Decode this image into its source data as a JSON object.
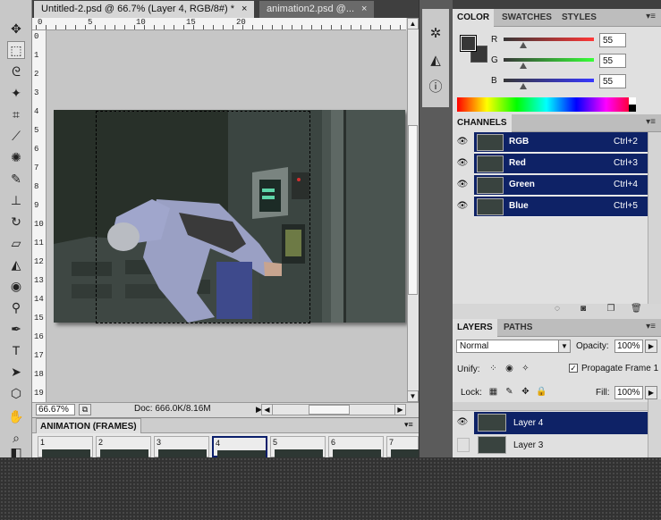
{
  "document": {
    "tabs": [
      {
        "label": "Untitled-2.psd @ 66.7% (Layer 4, RGB/8#) *",
        "active": true
      },
      {
        "label": "animation2.psd @...",
        "active": false
      }
    ],
    "close_glyph": "×",
    "ruler_h": [
      "0",
      "5",
      "10",
      "15",
      "20"
    ],
    "ruler_v": [
      "0",
      "1",
      "2",
      "3",
      "4",
      "5",
      "6",
      "7",
      "8",
      "9",
      "10",
      "11",
      "12",
      "13",
      "14",
      "15",
      "16",
      "17",
      "18",
      "19"
    ],
    "zoom": "66.67%",
    "doc_info": "Doc: 666.0K/8.16M"
  },
  "toolbox": {
    "tools": [
      {
        "name": "move-tool-icon",
        "glyph": "✥"
      },
      {
        "name": "marquee-tool-icon",
        "glyph": "⬚"
      },
      {
        "name": "lasso-tool-icon",
        "glyph": "ᘓ"
      },
      {
        "name": "magic-wand-tool-icon",
        "glyph": "✦"
      },
      {
        "name": "crop-tool-icon",
        "glyph": "⌗"
      },
      {
        "name": "eyedropper-tool-icon",
        "glyph": "⟋"
      },
      {
        "name": "spot-healing-tool-icon",
        "glyph": "✺"
      },
      {
        "name": "brush-tool-icon",
        "glyph": "✎"
      },
      {
        "name": "clone-stamp-tool-icon",
        "glyph": "⊥"
      },
      {
        "name": "history-brush-tool-icon",
        "glyph": "↻"
      },
      {
        "name": "eraser-tool-icon",
        "glyph": "▱"
      },
      {
        "name": "paint-bucket-tool-icon",
        "glyph": "◭"
      },
      {
        "name": "blur-tool-icon",
        "glyph": "◉"
      },
      {
        "name": "dodge-tool-icon",
        "glyph": "⚲"
      },
      {
        "name": "pen-tool-icon",
        "glyph": "✒"
      },
      {
        "name": "type-tool-icon",
        "glyph": "T"
      },
      {
        "name": "path-selection-tool-icon",
        "glyph": "➤"
      },
      {
        "name": "shape-tool-icon",
        "glyph": "⬡"
      },
      {
        "name": "hand-tool-icon",
        "glyph": "✋"
      },
      {
        "name": "zoom-tool-icon",
        "glyph": "⌕"
      },
      {
        "name": "color-swatches-icon",
        "glyph": "◧"
      }
    ]
  },
  "animation": {
    "title": "ANIMATION (FRAMES)",
    "frames": [
      "1",
      "2",
      "3",
      "4",
      "5",
      "6",
      "7"
    ],
    "selected_frame": "4",
    "menu_glyph": "▾≡"
  },
  "color_panel": {
    "tabs": [
      "COLOR",
      "SWATCHES",
      "STYLES"
    ],
    "sliders": [
      {
        "label": "R",
        "value": "55",
        "fraction": 0.216,
        "track": "linear-gradient(to right,#373737,#ff3737)"
      },
      {
        "label": "G",
        "value": "55",
        "fraction": 0.216,
        "track": "linear-gradient(to right,#373737,#37ff37)"
      },
      {
        "label": "B",
        "value": "55",
        "fraction": 0.216,
        "track": "linear-gradient(to right,#373737,#3737ff)"
      }
    ],
    "foreground": "#373737",
    "background": "#373737"
  },
  "channels_panel": {
    "title": "CHANNELS",
    "channels": [
      {
        "name": "RGB",
        "shortcut": "Ctrl+2"
      },
      {
        "name": "Red",
        "shortcut": "Ctrl+3"
      },
      {
        "name": "Green",
        "shortcut": "Ctrl+4"
      },
      {
        "name": "Blue",
        "shortcut": "Ctrl+5"
      }
    ]
  },
  "layers_panel": {
    "tabs": [
      "LAYERS",
      "PATHS"
    ],
    "blend_mode": "Normal",
    "opacity_label": "Opacity:",
    "opacity": "100%",
    "unify_label": "Unify:",
    "propagate_label": "Propagate Frame 1",
    "lock_label": "Lock:",
    "fill_label": "Fill:",
    "fill": "100%",
    "layers": [
      {
        "name": "Layer 4",
        "selected": true,
        "visible": true
      },
      {
        "name": "Layer 3",
        "selected": false,
        "visible": false
      }
    ]
  },
  "colors": {
    "selection_blue": "#0e2266"
  }
}
